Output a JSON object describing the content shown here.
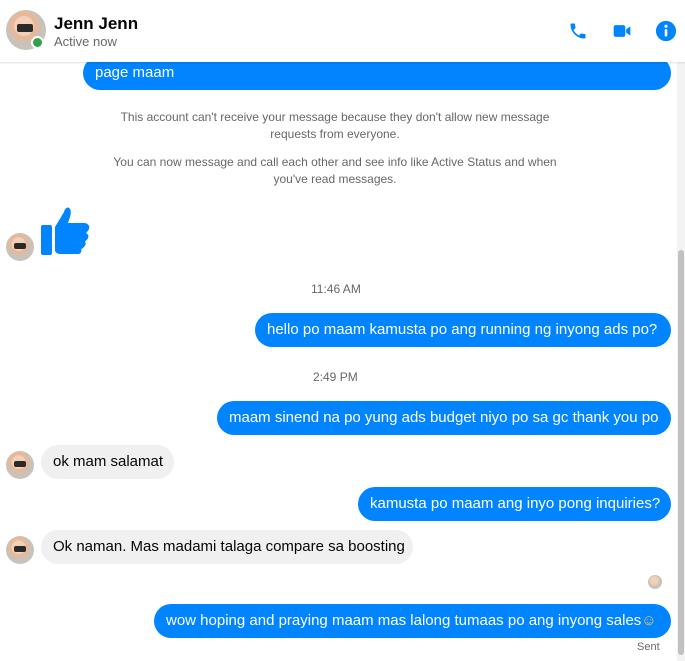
{
  "header": {
    "name": "Jenn Jenn",
    "status": "Active now",
    "icons": [
      "phone-icon",
      "video-camera-icon",
      "info-icon"
    ]
  },
  "colors": {
    "accent": "#0084ff",
    "online": "#31a24c",
    "incoming_bubble": "#f0f0f0"
  },
  "messages": {
    "m0": "page maam",
    "sys1": "This account can't receive your message because they don't allow new message requests from everyone.",
    "sys2": "You can now message and call each other and see info like Active Status and when you've read messages.",
    "like": "like-icon",
    "t1": "11:46 AM",
    "m1": "hello po maam kamusta po ang running ng inyong ads po?",
    "t2": "2:49 PM",
    "m2": "maam sinend na po yung ads budget niyo po sa gc thank you po",
    "m3": "ok mam salamat",
    "m4": "kamusta po maam ang inyo pong inquiries?",
    "m5": "Ok naman. Mas madami talaga compare sa boosting",
    "m6": "wow hoping and praying maam mas lalong tumaas po ang inyong sales",
    "m6_emoji": "☺",
    "sent": "Sent"
  }
}
